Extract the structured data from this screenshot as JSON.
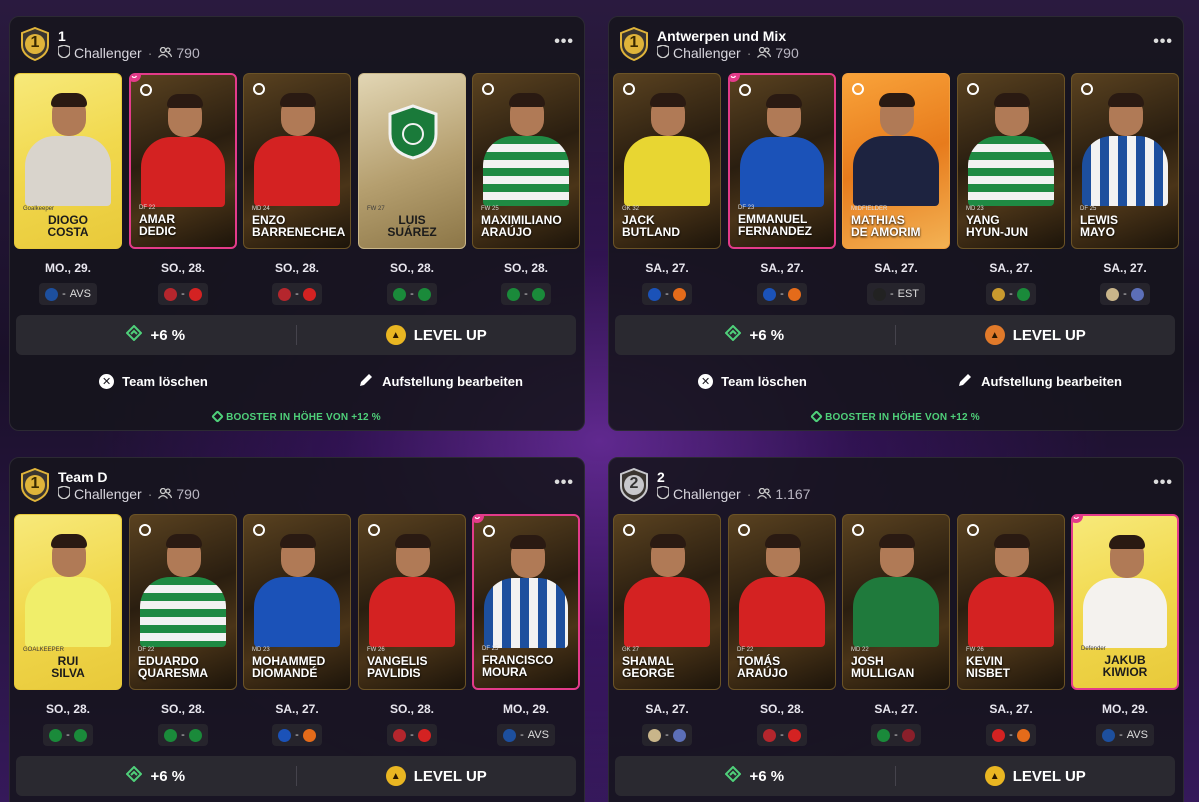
{
  "teams": [
    {
      "rank": "1",
      "rank_style": "gold",
      "name": "1",
      "league": "Challenger",
      "count": "790",
      "cards": [
        {
          "name": "Diogo\nCosta",
          "style": "gold",
          "captain": false,
          "shirt": "#d9d4cc",
          "meta": "Goalkeeper"
        },
        {
          "name": "AMAR\nDEDIC",
          "style": "dark",
          "captain": true,
          "shirt": "#d42222",
          "meta": "DF 22"
        },
        {
          "name": "ENZO\nBARRENECHEA",
          "style": "dark",
          "captain": false,
          "shirt": "#d42222",
          "meta": "MD 24"
        },
        {
          "name": "LUIS\nSUÁREZ",
          "style": "sil",
          "captain": false,
          "shirt": "none",
          "meta": "FW 27"
        },
        {
          "name": "MAXIMILIANO\nARAÚJO",
          "style": "dark",
          "captain": false,
          "shirt": "stripe-green",
          "meta": "FW 25"
        }
      ],
      "dates": [
        "MO., 29.",
        "SO., 28.",
        "SO., 28.",
        "SO., 28.",
        "SO., 28."
      ],
      "opp": [
        "AVS",
        "",
        "",
        "",
        ""
      ],
      "crests": [
        [
          "#1d4f9e",
          ""
        ],
        [
          "#b5262d",
          "#d42222"
        ],
        [
          "#b5262d",
          "#d42222"
        ],
        [
          "#1a8a3a",
          "#1a8a3a"
        ],
        [
          "#1a8a3a",
          "#1a8a3a"
        ]
      ],
      "boost": "+6 %",
      "level": "LEVEL UP",
      "level_style": "y",
      "delete": "Team löschen",
      "edit": "Aufstellung bearbeiten",
      "booster": "BOOSTER IN HÖHE VON +12 %"
    },
    {
      "rank": "1",
      "rank_style": "gold",
      "name": "Antwerpen und Mix",
      "league": "Challenger",
      "count": "790",
      "cards": [
        {
          "name": "JACK\nBUTLAND",
          "style": "dark",
          "captain": false,
          "shirt": "#e8d632",
          "meta": "GK 32"
        },
        {
          "name": "EMMANUEL\nFERNANDEZ",
          "style": "dark",
          "captain": true,
          "shirt": "#1b52b8",
          "meta": "DF 23"
        },
        {
          "name": "MATHIAS\nDE AMORIM",
          "style": "orange",
          "captain": false,
          "shirt": "#1d2340",
          "meta": "MIDFIELDER"
        },
        {
          "name": "YANG\nHYUN-JUN",
          "style": "dark",
          "captain": false,
          "shirt": "stripe-green",
          "meta": "MD 23"
        },
        {
          "name": "LEWIS\nMAYO",
          "style": "dark",
          "captain": false,
          "shirt": "stripe-blue",
          "meta": "DF 25"
        }
      ],
      "dates": [
        "SA., 27.",
        "SA., 27.",
        "SA., 27.",
        "SA., 27.",
        "SA., 27."
      ],
      "opp": [
        "",
        "",
        "EST",
        "",
        ""
      ],
      "crests": [
        [
          "#1b52b8",
          "#e46b1a"
        ],
        [
          "#1b52b8",
          "#e46b1a"
        ],
        [
          "#222",
          ""
        ],
        [
          "#c99a2e",
          "#1a8a3a"
        ],
        [
          "#c9b58a",
          "#5c6fb8"
        ]
      ],
      "boost": "+6 %",
      "level": "LEVEL UP",
      "level_style": "o",
      "delete": "Team löschen",
      "edit": "Aufstellung bearbeiten",
      "booster": "BOOSTER IN HÖHE VON +12 %"
    },
    {
      "rank": "1",
      "rank_style": "gold",
      "name": "Team D",
      "league": "Challenger",
      "count": "790",
      "cards": [
        {
          "name": "RUI\nSILVA",
          "style": "gold",
          "captain": false,
          "shirt": "#f0ee6a",
          "meta": "GOALKEEPER"
        },
        {
          "name": "EDUARDO\nQUARESMA",
          "style": "dark",
          "captain": false,
          "shirt": "stripe-green",
          "meta": "DF 22"
        },
        {
          "name": "MOHAMMED\nDIOMANDÉ",
          "style": "dark",
          "captain": false,
          "shirt": "#1b52b8",
          "meta": "MD 23"
        },
        {
          "name": "VANGELIS\nPAVLIDIS",
          "style": "dark",
          "captain": false,
          "shirt": "#d42222",
          "meta": "FW 26"
        },
        {
          "name": "FRANCISCO\nMOURA",
          "style": "dark",
          "captain": true,
          "shirt": "stripe-blue",
          "meta": "DF 25"
        }
      ],
      "dates": [
        "SO., 28.",
        "SO., 28.",
        "SA., 27.",
        "SO., 28.",
        "MO., 29."
      ],
      "opp": [
        "",
        "",
        "",
        "",
        "AVS"
      ],
      "crests": [
        [
          "#1a8a3a",
          "#1a8a3a"
        ],
        [
          "#1a8a3a",
          "#1a8a3a"
        ],
        [
          "#1b52b8",
          "#e46b1a"
        ],
        [
          "#b5262d",
          "#d42222"
        ],
        [
          "#1d4f9e",
          ""
        ]
      ],
      "boost": "+6 %",
      "level": "LEVEL UP",
      "level_style": "y"
    },
    {
      "rank": "2",
      "rank_style": "silver",
      "name": "2",
      "league": "Challenger",
      "count": "1.167",
      "cards": [
        {
          "name": "SHAMAL\nGEORGE",
          "style": "dark",
          "captain": false,
          "shirt": "#d42222",
          "meta": "GK 27"
        },
        {
          "name": "TOMÁS\nARAÚJO",
          "style": "dark",
          "captain": false,
          "shirt": "#d42222",
          "meta": "DF 22"
        },
        {
          "name": "JOSH\nMULLIGAN",
          "style": "dark",
          "captain": false,
          "shirt": "#1f7a3c",
          "meta": "MD 22"
        },
        {
          "name": "KEVIN\nNISBET",
          "style": "dark",
          "captain": false,
          "shirt": "#d42222",
          "meta": "FW 26"
        },
        {
          "name": "Jakub\nKiwior",
          "style": "gold",
          "captain": true,
          "shirt": "#f4f2ee",
          "meta": "Defender"
        }
      ],
      "dates": [
        "SA., 27.",
        "SO., 28.",
        "SA., 27.",
        "SA., 27.",
        "MO., 29."
      ],
      "opp": [
        "",
        "",
        "",
        "",
        "AVS"
      ],
      "crests": [
        [
          "#c9b58a",
          "#5c6fb8"
        ],
        [
          "#b5262d",
          "#d42222"
        ],
        [
          "#1a8a3a",
          "#8a1f2a"
        ],
        [
          "#d42222",
          "#e46b1a"
        ],
        [
          "#1d4f9e",
          ""
        ]
      ],
      "boost": "+6 %",
      "level": "LEVEL UP",
      "level_style": "y"
    }
  ]
}
